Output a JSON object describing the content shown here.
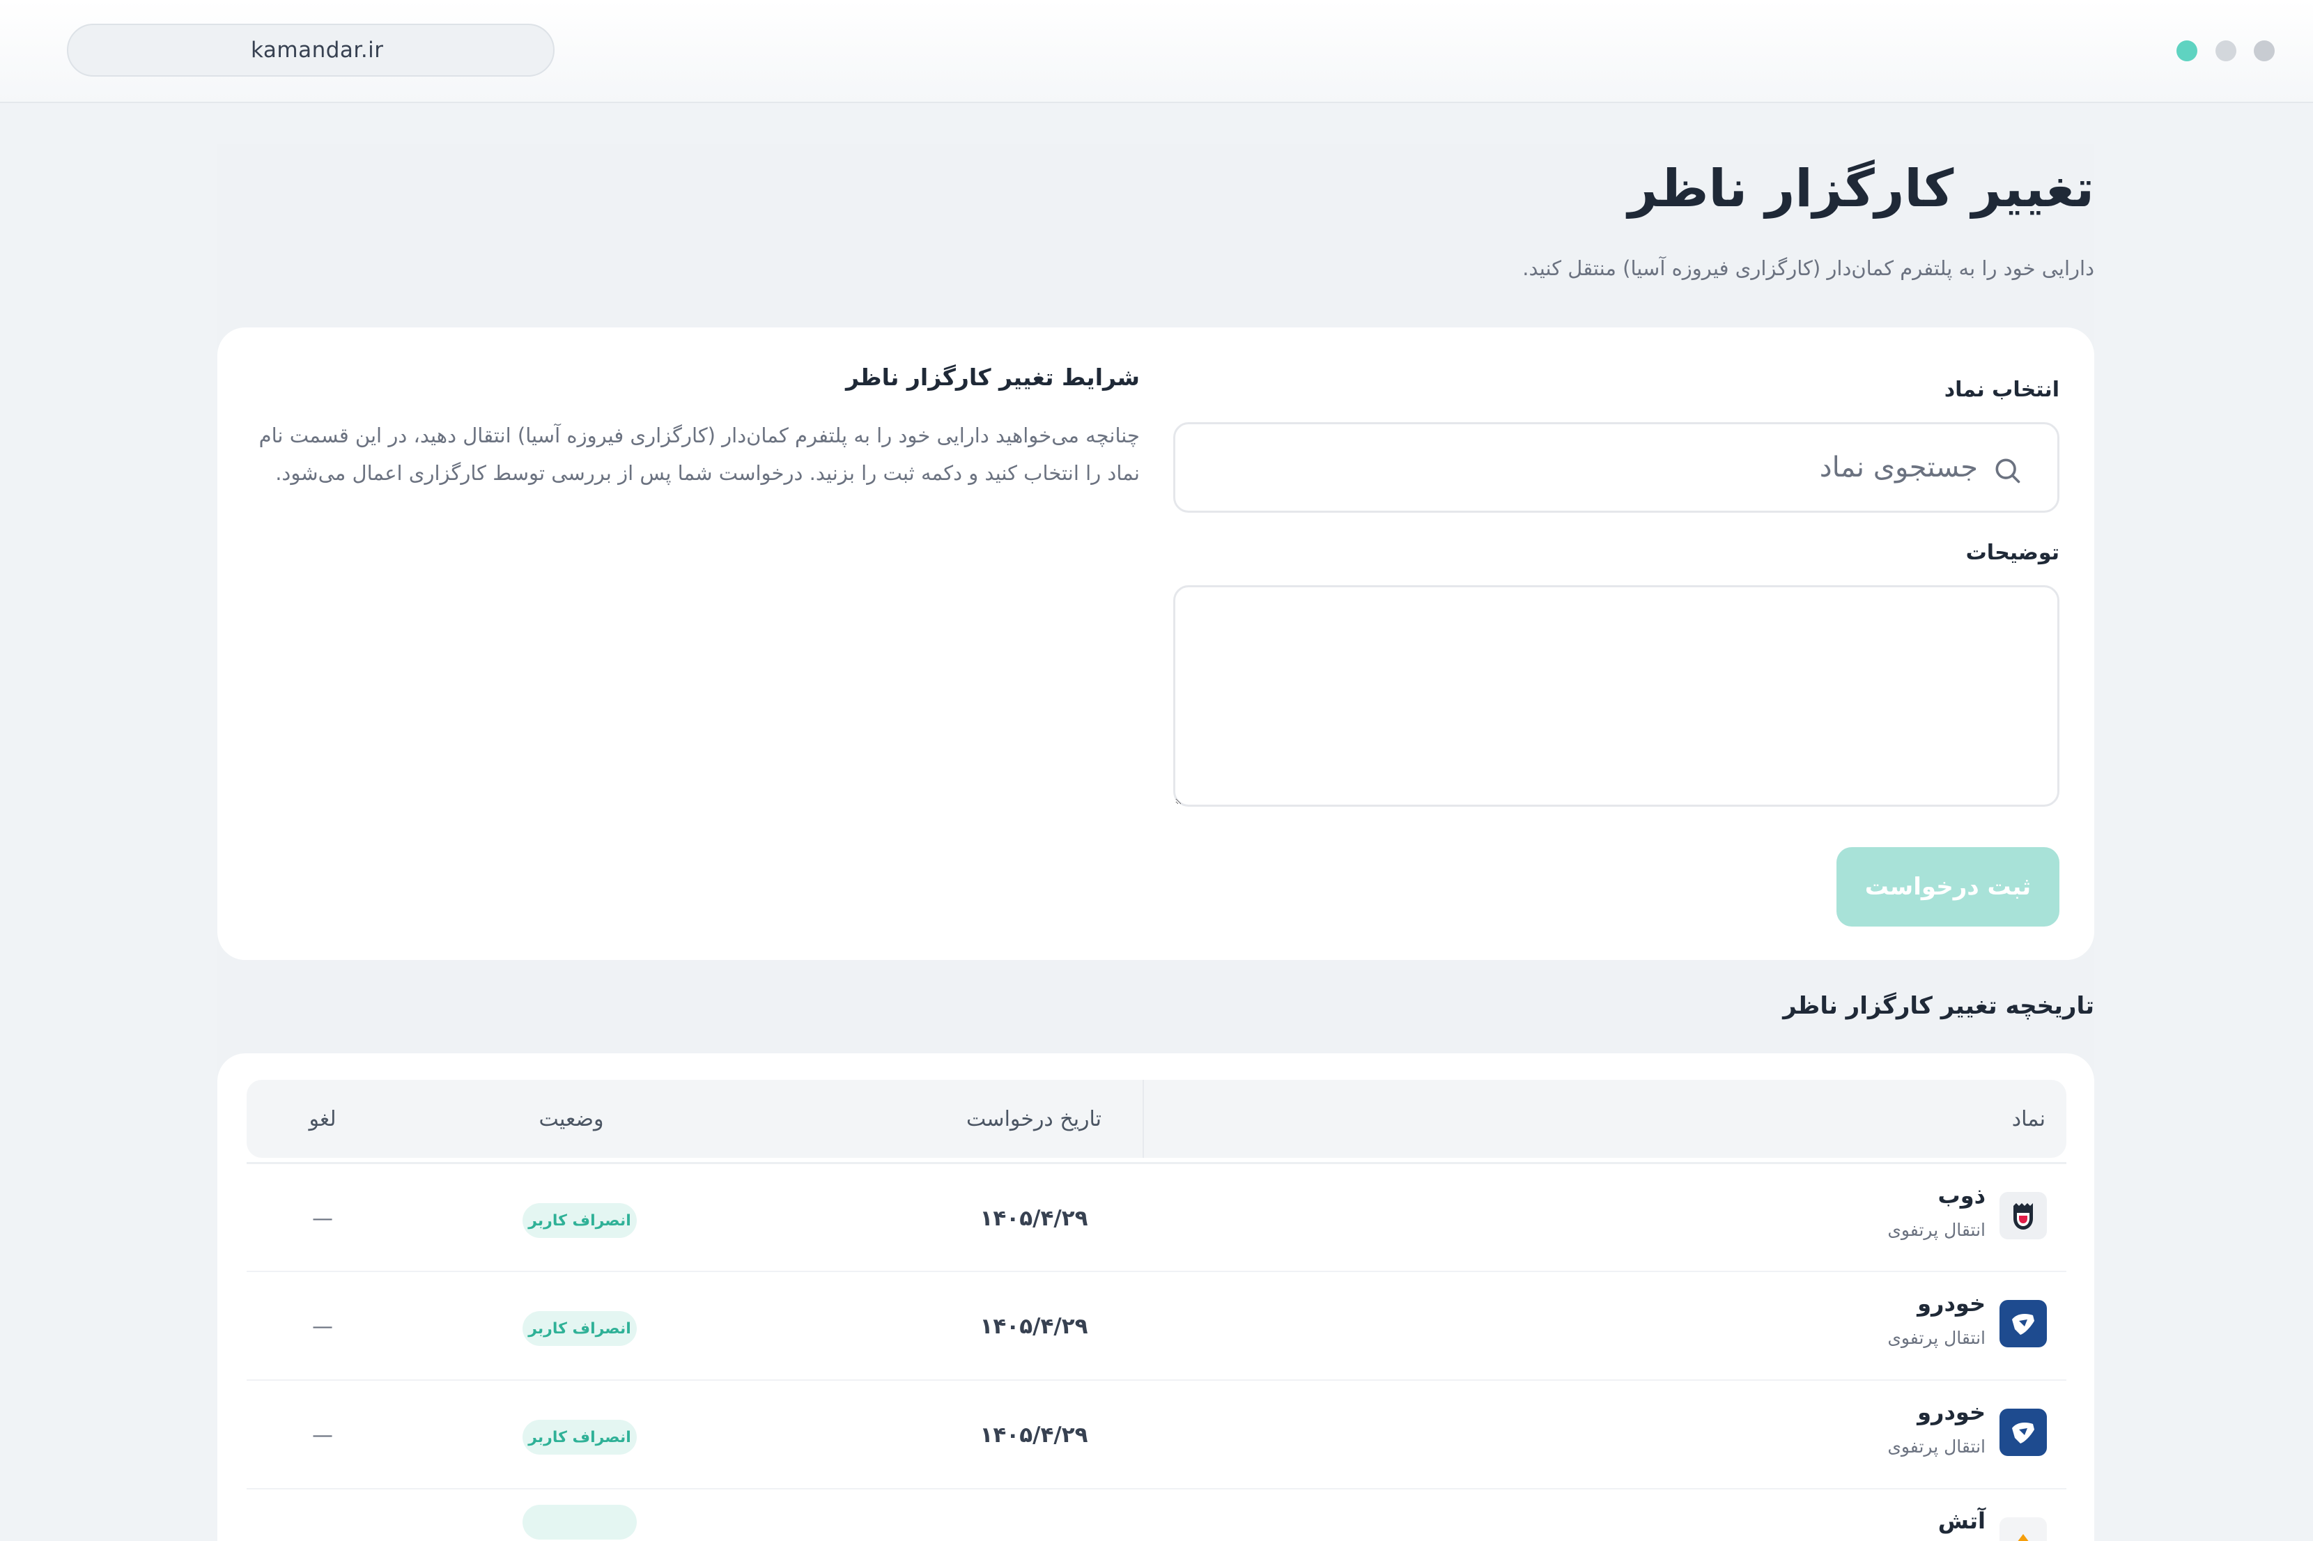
{
  "browser": {
    "url": "kamandar.ir",
    "window_dots": [
      "#5fd3c1",
      "#d3d7dc",
      "#c8ccd2"
    ]
  },
  "page": {
    "title": "تغییر کارگزار ناظر",
    "subtitle": "دارایی خود را به پلتفرم کمان‌دار (کارگزاری فیروزه آسیا) منتقل کنید."
  },
  "form": {
    "symbol_label": "انتخاب نماد",
    "symbol_placeholder": "جستجوی نماد",
    "description_label": "توضیحات",
    "submit_label": "ثبت درخواست",
    "submit_color": "#a8e2d8"
  },
  "terms": {
    "title": "شرایط تغییر کارگزار ناظر",
    "body": "چنانچه می‌خواهید دارایی خود را به پلتفرم کمان‌دار (کارگزاری فیروزه آسیا) انتقال دهید، در این قسمت نام نماد را انتخاب کنید و دکمه ثبت را بزنید. درخواست شما پس از بررسی توسط کارگزاری اعمال می‌شود."
  },
  "history": {
    "title": "تاریخچه تغییر کارگزار ناظر",
    "columns": {
      "symbol": "نماد",
      "date": "تاریخ درخواست",
      "status": "وضعیت",
      "cancel": "لغو"
    },
    "rows": [
      {
        "symbol": "ذوب",
        "subtitle": "انتقال پرتفوی",
        "date": "۱۴۰۵/۴/۲۹",
        "status": "انصراف کاربر",
        "cancel": "—",
        "icon": "steel-mill-logo-icon"
      },
      {
        "symbol": "خودرو",
        "subtitle": "انتقال پرتفوی",
        "date": "۱۴۰۵/۴/۲۹",
        "status": "انصراف کاربر",
        "cancel": "—",
        "icon": "iran-khodro-logo-icon"
      },
      {
        "symbol": "خودرو",
        "subtitle": "انتقال پرتفوی",
        "date": "۱۴۰۵/۴/۲۹",
        "status": "انصراف کاربر",
        "cancel": "—",
        "icon": "iran-khodro-logo-icon"
      },
      {
        "symbol": "آتش",
        "subtitle": "",
        "date": "",
        "status": "",
        "cancel": "",
        "icon": "company-logo-icon"
      }
    ],
    "status_color": "#2fb197"
  }
}
